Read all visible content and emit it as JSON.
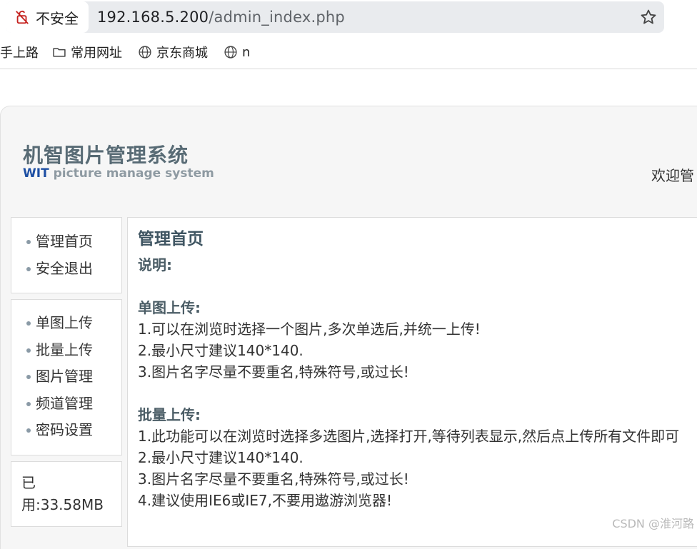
{
  "browser": {
    "security_label": "不安全",
    "url_host": "192.168.5.200",
    "url_path": "/admin_index.php",
    "bookmarks": [
      {
        "label": "手上路",
        "icon": "none"
      },
      {
        "label": "常用网址",
        "icon": "folder-icon"
      },
      {
        "label": "京东商城",
        "icon": "globe-icon"
      },
      {
        "label": "n",
        "icon": "globe-icon"
      }
    ]
  },
  "header": {
    "logo_cn": "机智图片管理系统",
    "logo_en_brand": "WIT",
    "logo_en_text": "picture manage system",
    "welcome": "欢迎管"
  },
  "sidebar": {
    "group1": [
      "管理首页",
      "安全退出"
    ],
    "group2": [
      "单图上传",
      "批量上传",
      "图片管理",
      "频道管理",
      "密码设置"
    ],
    "usage": [
      "已",
      "用:33.58MB"
    ]
  },
  "main": {
    "title": "管理首页",
    "intro": "说明:",
    "single_heading": "单图上传:",
    "single_items": [
      "1.可以在浏览时选择一个图片,多次单选后,并统一上传!",
      "2.最小尺寸建议140*140.",
      "3.图片名字尽量不要重名,特殊符号,或过长!"
    ],
    "batch_heading": "批量上传:",
    "batch_items": [
      "1.此功能可以在浏览时选择多选图片,选择打开,等待列表显示,然后点上传所有文件即可",
      "2.最小尺寸建议140*140.",
      "3.图片名字尽量不要重名,特殊符号,或过长!",
      "4.建议使用IE6或IE7,不要用遨游浏览器!"
    ]
  },
  "watermark": "CSDN @淮河路",
  "colors": {
    "logo": "#586b75",
    "brand_blue": "#1d4fa3",
    "bullet": "#8a9aa6",
    "heading": "#3f5562"
  }
}
